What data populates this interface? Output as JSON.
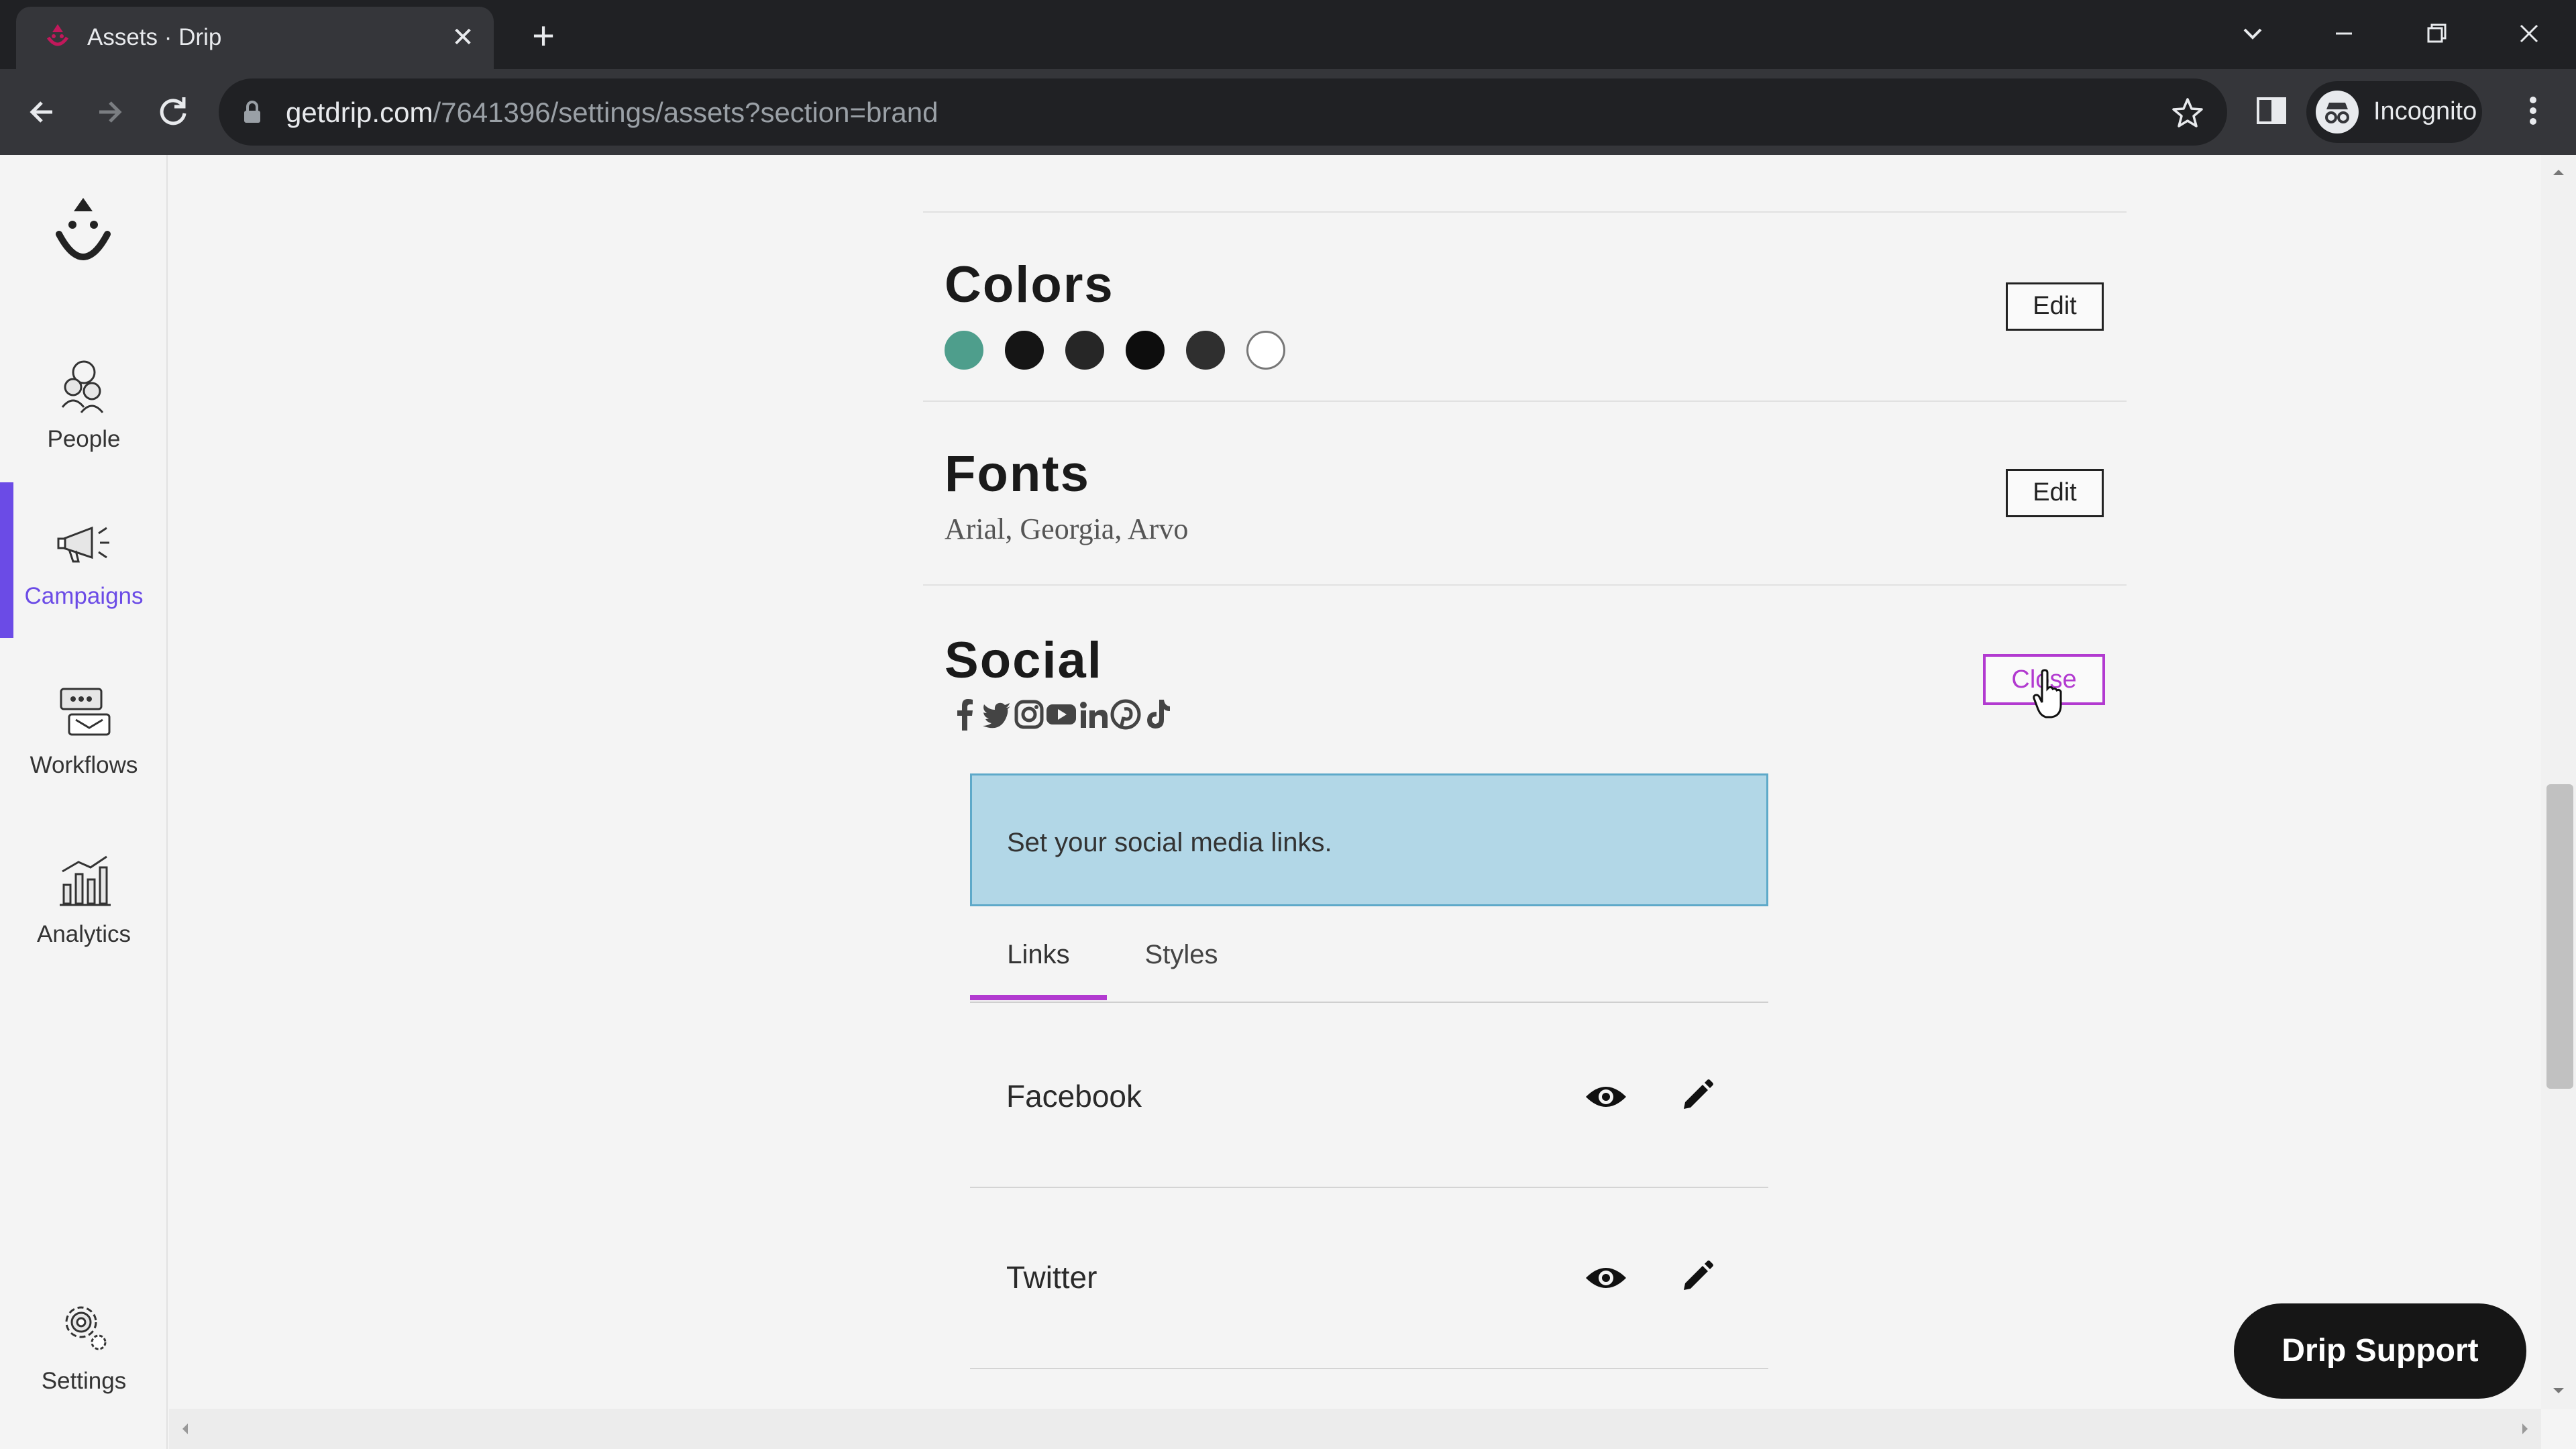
{
  "browser": {
    "tab_title": "Assets · Drip",
    "new_tab_label": "+",
    "url_host": "getdrip.com",
    "url_path": "/7641396/settings/assets?section=brand",
    "profile_label": "Incognito"
  },
  "sidebar": {
    "items": [
      {
        "label": "People",
        "icon": "people-icon"
      },
      {
        "label": "Campaigns",
        "icon": "megaphone-icon",
        "active": true
      },
      {
        "label": "Workflows",
        "icon": "workflows-icon"
      },
      {
        "label": "Analytics",
        "icon": "analytics-icon"
      },
      {
        "label": "Settings",
        "icon": "gear-icon"
      }
    ]
  },
  "colors": {
    "title": "Colors",
    "edit_label": "Edit",
    "swatches": [
      "#4e9e8c",
      "#151515",
      "#262626",
      "#0d0d0d",
      "#2f2f2f",
      "#ffffff"
    ]
  },
  "fonts": {
    "title": "Fonts",
    "list": "Arial, Georgia, Arvo",
    "edit_label": "Edit"
  },
  "social": {
    "title": "Social",
    "close_label": "Close",
    "networks": [
      "facebook-icon",
      "twitter-icon",
      "instagram-icon",
      "youtube-icon",
      "linkedin-icon",
      "pinterest-icon",
      "tiktok-icon"
    ],
    "info": "Set your social media links.",
    "tabs": [
      {
        "label": "Links",
        "active": true
      },
      {
        "label": "Styles",
        "active": false
      }
    ],
    "links": [
      {
        "name": "Facebook"
      },
      {
        "name": "Twitter"
      }
    ]
  },
  "support_button": "Drip Support",
  "accent_colors": {
    "brand_purple": "#6b4be6",
    "close_magenta": "#b23ad0",
    "info_blue": "#b2d7e7"
  }
}
